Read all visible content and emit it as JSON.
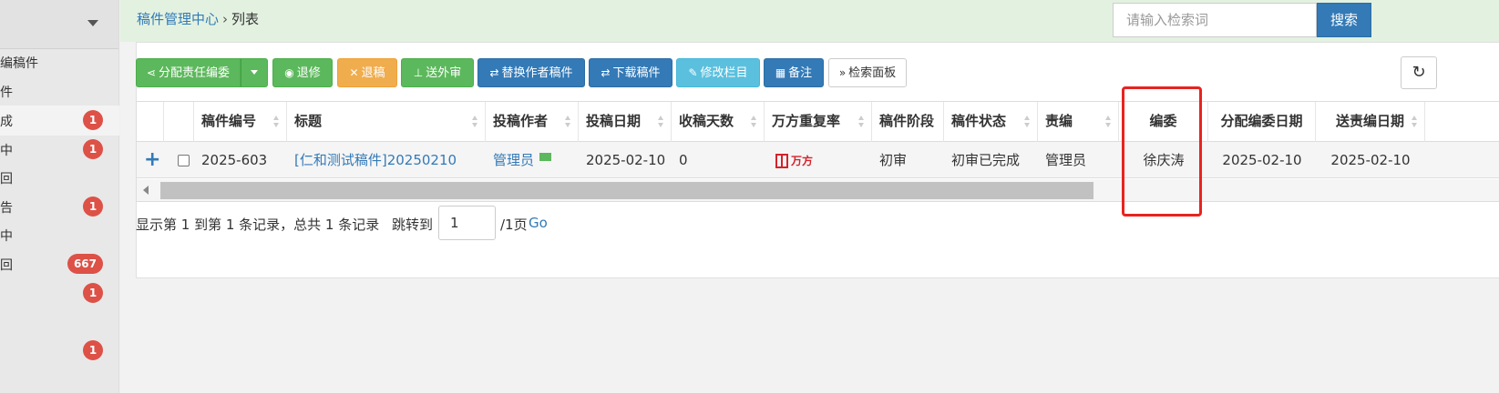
{
  "sidebar": {
    "items": [
      {
        "label": "编稿件",
        "badge": ""
      },
      {
        "label": "件",
        "badge": ""
      },
      {
        "label": "成",
        "badge": "1"
      },
      {
        "label": "中",
        "badge": "1"
      },
      {
        "label": "回",
        "badge": ""
      },
      {
        "label": "告",
        "badge": "1"
      },
      {
        "label": "中",
        "badge": ""
      },
      {
        "label": "回",
        "badge": "667"
      },
      {
        "label": "",
        "badge": "1"
      },
      {
        "label": "",
        "badge": "1"
      }
    ]
  },
  "breadcrumb": {
    "root": "稿件管理中心",
    "sep": "›",
    "current": "列表"
  },
  "search": {
    "placeholder": "请输入检索词",
    "button": "搜索"
  },
  "toolbar": {
    "assign": "分配责任编委",
    "back": "退修",
    "reject": "退稿",
    "external": "送外审",
    "replace": "替换作者稿件",
    "download": "下载稿件",
    "columns": "修改栏目",
    "note": "备注",
    "search_panel": "检索面板"
  },
  "table": {
    "headers": [
      "稿件编号",
      "标题",
      "投稿作者",
      "投稿日期",
      "收稿天数",
      "万方重复率",
      "稿件阶段",
      "稿件状态",
      "责编",
      "编委",
      "分配编委日期",
      "送责编日期"
    ],
    "row": {
      "id": "2025-603",
      "title": "[仁和测试稿件]20250210",
      "author": "管理员",
      "date": "2025-02-10",
      "days": "0",
      "wanfang": "万方",
      "stage": "初审",
      "status": "初审已完成",
      "editor": "管理员",
      "committee": "徐庆涛",
      "assign_date": "2025-02-10",
      "send_date": "2025-02-10"
    }
  },
  "pager": {
    "summary": "显示第 1 到第 1 条记录，总共 1 条记录",
    "jump_label": "跳转到",
    "page_value": "1",
    "total": "/1页",
    "go": "Go"
  },
  "colors": {
    "accent": "#337ab7",
    "green": "#5cb85c",
    "orange": "#f0ad4e",
    "info": "#5bc0de",
    "badge": "#dd5147",
    "highlight": "#e8231f"
  }
}
